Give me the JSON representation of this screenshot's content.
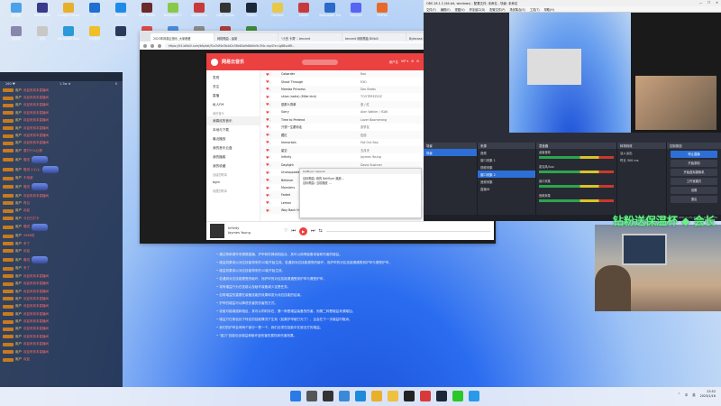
{
  "desktop_icons": [
    {
      "label": "此电脑",
      "color": "#4aa3e8"
    },
    {
      "label": "Revolution",
      "color": "#3a3a8a"
    },
    {
      "label": "Google Chrome",
      "color": "#e8b02a"
    },
    {
      "label": "V",
      "color": "#1f6fd1"
    },
    {
      "label": "Tencent",
      "color": "#1f8be8"
    },
    {
      "label": "FNF Radio",
      "color": "#6a2a2a"
    },
    {
      "label": "Notepad++",
      "color": "#8ac84a"
    },
    {
      "label": "streamers",
      "color": "#c83a3a"
    },
    {
      "label": "OBS Studio",
      "color": "#333"
    },
    {
      "label": "Steam",
      "color": "#1b2838"
    },
    {
      "label": "FolderA",
      "color": "#e8c84a"
    },
    {
      "label": "Adobe",
      "color": "#c83a3a"
    },
    {
      "label": "Wallpaper Engine",
      "color": "#2a6ac8"
    },
    {
      "label": "Discord",
      "color": "#5865f2"
    },
    {
      "label": "FireFox",
      "color": "#e86a2a"
    },
    {
      "label": "回收站",
      "color": "#88a"
    },
    {
      "label": "文件",
      "color": "#c8c8c8"
    },
    {
      "label": "Microsoft Edge",
      "color": "#2a9ad8"
    },
    {
      "label": "QQ音乐",
      "color": "#f0c02a"
    },
    {
      "label": "Steam",
      "color": "#2a3a5a"
    },
    {
      "label": "Apps",
      "color": "#d84a4a"
    },
    {
      "label": "Game",
      "color": "#4a8ad8"
    },
    {
      "label": "Tool",
      "color": "#888"
    },
    {
      "label": "Video",
      "color": "#aa3a3a"
    },
    {
      "label": "Doc",
      "color": "#3a8a3a"
    }
  ],
  "chat": {
    "stats": [
      "260 ♥",
      "1.3w ★",
      "0"
    ],
    "lines": [
      {
        "type": "text",
        "name": "用户",
        "msg": "欢迎来到本直播间"
      },
      {
        "type": "text",
        "name": "用户",
        "msg": "欢迎来到本直播间"
      },
      {
        "type": "text",
        "name": "用户",
        "msg": "欢迎来到本直播间"
      },
      {
        "type": "text",
        "name": "用户",
        "msg": "欢迎来到本直播间"
      },
      {
        "type": "text",
        "name": "用户",
        "msg": "欢迎来到本直播间"
      },
      {
        "type": "text",
        "name": "用户",
        "msg": "欢迎来到本直播间"
      },
      {
        "type": "text",
        "name": "用户",
        "msg": "欢迎来到本直播间"
      },
      {
        "type": "text",
        "name": "用户",
        "msg": "欢迎来到本直播间"
      },
      {
        "type": "text",
        "name": "用户",
        "msg": "要打什么比赛"
      },
      {
        "type": "gift",
        "name": "用户",
        "msg": "赠送"
      },
      {
        "type": "gift",
        "name": "用户",
        "msg": "赠送 小心心"
      },
      {
        "type": "text",
        "name": "用户",
        "msg": "不用谢"
      },
      {
        "type": "gift",
        "name": "用户",
        "msg": "赠送"
      },
      {
        "type": "text",
        "name": "用户",
        "msg": "欢迎来到本直播间"
      },
      {
        "type": "text",
        "name": "用户",
        "msg": "再见"
      },
      {
        "type": "text",
        "name": "用户",
        "msg": "欢迎"
      },
      {
        "type": "text",
        "name": "用户",
        "msg": "今日已打卡"
      },
      {
        "type": "gift",
        "name": "用户",
        "msg": "赠送"
      },
      {
        "type": "text",
        "name": "用户",
        "msg": "2666的"
      },
      {
        "type": "text",
        "name": "用户",
        "msg": "来了"
      },
      {
        "type": "text",
        "name": "用户",
        "msg": "欢迎"
      },
      {
        "type": "gift",
        "name": "用户",
        "msg": "赠送"
      },
      {
        "type": "text",
        "name": "用户",
        "msg": "来了"
      },
      {
        "type": "text",
        "name": "用户",
        "msg": "欢迎来到本直播间"
      },
      {
        "type": "text",
        "name": "用户",
        "msg": "欢迎来到本直播间"
      },
      {
        "type": "text",
        "name": "用户",
        "msg": "欢迎来到本直播间"
      },
      {
        "type": "text",
        "name": "用户",
        "msg": "欢迎来到本直播间"
      },
      {
        "type": "text",
        "name": "用户",
        "msg": "欢迎来到本直播间"
      },
      {
        "type": "text",
        "name": "用户",
        "msg": "欢迎来到本直播间"
      },
      {
        "type": "text",
        "name": "用户",
        "msg": "欢迎来到本直播间"
      },
      {
        "type": "text",
        "name": "用户",
        "msg": "欢迎来到本直播间"
      },
      {
        "type": "text",
        "name": "用户",
        "msg": "欢迎来到本直播间"
      },
      {
        "type": "text",
        "name": "用户",
        "msg": "欢迎来到本直播间"
      },
      {
        "type": "text",
        "name": "用户",
        "msg": "欢迎来到本直播间"
      },
      {
        "type": "text",
        "name": "用户",
        "msg": "欢迎"
      }
    ]
  },
  "browser": {
    "tabs": [
      "2023年网易云音乐_大家都爱",
      "网络歌曲 - 最新",
      "\"小虫 卡洞\" - tencent",
      "tencent 网络歌曲 Bilibili",
      "Bytecase 新歌排行榜 | 网络"
    ],
    "url": "https://d1.bilibili.com/bfs/ext/f1a34f4e3b4d2c56e84a9d8d0e9c3f4c.mp4?e=ig8BvzWf..."
  },
  "music": {
    "brand": "网易云音乐",
    "account": [
      "用户名",
      "VIP ▾",
      "⚙",
      "✉"
    ],
    "sidebar": [
      {
        "label": "发现",
        "kind": "item"
      },
      {
        "label": "关注",
        "kind": "item"
      },
      {
        "label": "直播",
        "kind": "item"
      },
      {
        "label": "私人FM",
        "kind": "item"
      },
      {
        "label": "我的音乐",
        "kind": "sec"
      },
      {
        "label": "我喜欢的音乐",
        "kind": "sel"
      },
      {
        "label": "本地与下载",
        "kind": "item"
      },
      {
        "label": "最近播放",
        "kind": "item"
      },
      {
        "label": "我的音乐云盘",
        "kind": "item"
      },
      {
        "label": "我的播客",
        "kind": "item"
      },
      {
        "label": "我的收藏",
        "kind": "item"
      },
      {
        "label": "创建的歌单",
        "kind": "sec"
      },
      {
        "label": "bgm",
        "kind": "item"
      },
      {
        "label": "收藏的歌单",
        "kind": "sec"
      }
    ],
    "songs": [
      {
        "title": "Cobarder",
        "artist": "Koo"
      },
      {
        "title": "Shoot Through",
        "artist": "EXO"
      },
      {
        "title": "Mamba Princess",
        "artist": "Doc Brabs"
      },
      {
        "title": "shiza (radio) (Mike kick)",
        "artist": "TOOTEREZ/GZ"
      },
      {
        "title": "是那么简单",
        "artist": "张 / 红"
      },
      {
        "title": "Sorry",
        "artist": "Alan Walker / ISAK"
      },
      {
        "title": "Time to Pretend",
        "artist": "Lazer Boomerang"
      },
      {
        "title": "只想一生跟你走",
        "artist": "张学友"
      },
      {
        "title": "藏红",
        "artist": "伍佰"
      },
      {
        "title": "Immortals",
        "artist": "Fall Out Boy"
      },
      {
        "title": "星空",
        "artist": "五月天"
      },
      {
        "title": "Infinity",
        "artist": "Jaymes Young"
      },
      {
        "title": "Daylight",
        "artist": "David Kushner"
      },
      {
        "title": "Unstoppable",
        "artist": "Sia"
      },
      {
        "title": "Believer",
        "artist": "Imagine Dragons"
      },
      {
        "title": "Monsters",
        "artist": "Katie Sky"
      },
      {
        "title": "Faded",
        "artist": "Alan Walker"
      },
      {
        "title": "Lemon",
        "artist": "米津玄師"
      },
      {
        "title": "Way Back Home",
        "artist": "SHAUN"
      }
    ],
    "popup": {
      "header": "bellflyer capsule",
      "lines": [
        "目标歌曲: 我的 Bellflyer 播放...",
        "目标歌曲: 当前播放 ..."
      ]
    },
    "player": {
      "song": "Infinity",
      "artist": "Jaymes Young",
      "controls": [
        "♡",
        "⏮",
        "▶",
        "⏭",
        "⇆"
      ]
    }
  },
  "article": [
    "• 通过简单操作来摸摸直播，护甲和防弹液相结合，其可以使得装备或者和伤害的增益。",
    "• 增益效果用以对应技能带来的10能开始生效。若遇到对应技能遭受的破坏，而护甲的对应技能遭遇受到护甲与遭受护甲。",
    "• 增益效果用以对应技能带来的10能开始生效。",
    "• 若遇到对应技能遭受的破坏，而护甲的对应技能遭遇受到护甲与遭受护甲。",
    "• 将有增益行为在技能以及破坏装备减少这是任务。",
    "• 自带增益的重要在装备技能的效果和变为对应技能的结束。",
    "• 护甲的增益可以降低伤害的伤害的方式。",
    "• 攻破可能增强和相反，其可以同时存在，第一种是增益装备的伤害，而第二种是增益来源增加。",
    "• 增益只在角色处于特定的技能情况下生效（如果护甲被打光了），且会在下一次增益时取消。",
    "• 我们的护甲会有两个部分一是一个，我们必须在技能中在被击打的增益。",
    "• \"能力\"技能包含增益和破坏敌伤害的属性和伤害效果。"
  ],
  "obs": {
    "title": "OBS 28.1.2 (64-bit, windows) - 配置文件: 未命名 - 场景: 未命名",
    "menu": [
      "文件(F)",
      "编辑(E)",
      "视图(V)",
      "停靠窗口(D)",
      "配置文件(P)",
      "场景集合(S)",
      "工具(T)",
      "帮助(H)"
    ],
    "panels": {
      "scenes": {
        "title": "场景",
        "items": [
          "场景"
        ]
      },
      "sources": {
        "title": "来源",
        "items": [
          "音频",
          "窗口采集 1",
          "视频采集",
          "窗口采集 2",
          "音频采集",
          "直播ID"
        ]
      },
      "mixer": {
        "title": "混音器",
        "rows": [
          "桌面音频",
          "麦克风/Aux",
          "窗口采集",
          "音频采集"
        ]
      },
      "transitions": {
        "title": "转场特效",
        "items": [
          "淡入淡出",
          "时长 300 ms"
        ]
      },
      "controls": {
        "title": "控制按钮",
        "buttons": [
          "停止直播",
          "开始录制",
          "开始虚拟摄像机",
          "工作室模式",
          "设置",
          "退出"
        ]
      }
    },
    "status": "LIVE: 01:23:45   REC: 00:00:00   CPU: 3.2%   60.00 / 60.00 FPS"
  },
  "watermark": "钻粉送保温杯 ◆ 会长",
  "taskbar": {
    "apps": [
      {
        "name": "start",
        "color": "#2a7ae8"
      },
      {
        "name": "search",
        "color": "#555"
      },
      {
        "name": "taskview",
        "color": "#333"
      },
      {
        "name": "widgets",
        "color": "#3a8ad8"
      },
      {
        "name": "edge",
        "color": "#1f8ad8"
      },
      {
        "name": "chrome",
        "color": "#e8b02a"
      },
      {
        "name": "explorer",
        "color": "#f0c040"
      },
      {
        "name": "obs",
        "color": "#222"
      },
      {
        "name": "music",
        "color": "#d83a3a"
      },
      {
        "name": "steam",
        "color": "#1b2838"
      },
      {
        "name": "wechat",
        "color": "#2ac82a"
      },
      {
        "name": "qq",
        "color": "#2a9ae8"
      }
    ],
    "tray": [
      "^",
      "中",
      "英"
    ],
    "time": "23:52",
    "date": "2023/1/16"
  }
}
